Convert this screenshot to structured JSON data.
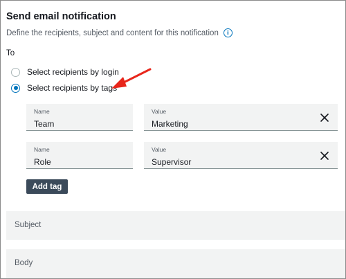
{
  "header": {
    "title": "Send email notification",
    "description": "Define the recipients, subject and content for this notification"
  },
  "to": {
    "label": "To",
    "options": [
      {
        "label": "Select recipients by login",
        "selected": false
      },
      {
        "label": "Select recipients by tags",
        "selected": true
      }
    ]
  },
  "tags": [
    {
      "name_label": "Name",
      "name": "Team",
      "value_label": "Value",
      "value": "Marketing"
    },
    {
      "name_label": "Name",
      "name": "Role",
      "value_label": "Value",
      "value": "Supervisor"
    }
  ],
  "add_tag_label": "Add tag",
  "sections": {
    "subject": "Subject",
    "body": "Body"
  },
  "colors": {
    "accent": "#0073bb",
    "button": "#3b4a5a",
    "annotation_arrow": "#e8261b"
  },
  "icons": {
    "info": "info-icon",
    "remove": "close-icon"
  }
}
